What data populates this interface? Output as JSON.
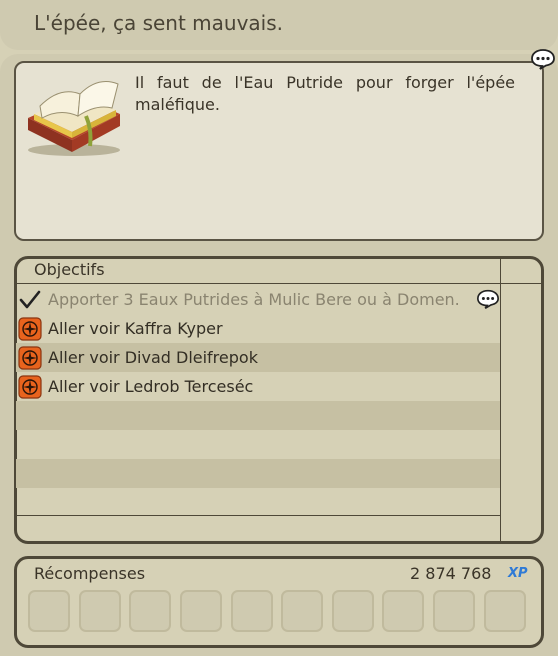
{
  "header": {
    "title": "L'épée, ça sent mauvais."
  },
  "description": {
    "text": "Il faut de l'Eau Putride pour forger l'épée maléfique."
  },
  "objectives": {
    "heading": "Objectifs",
    "items": [
      {
        "label": "Apporter 3 Eaux Putrides à Mulic Bere ou à Domen.",
        "status": "done"
      },
      {
        "label": "Aller voir Kaffra Kyper",
        "status": "pending"
      },
      {
        "label": "Aller voir Divad Dleifrepok",
        "status": "pending"
      },
      {
        "label": "Aller voir Ledrob Terceséc",
        "status": "pending"
      }
    ]
  },
  "rewards": {
    "heading": "Récompenses",
    "xp_value": "2 874 768",
    "xp_badge": "XP"
  },
  "colors": {
    "panel": "#cfcab0",
    "border": "#4e4838",
    "objective_icon": "#e8631d",
    "xp_badge": "#2f7ad6"
  },
  "icons": [
    "book-icon",
    "chat-bubble-icon",
    "checkmark-icon",
    "compass-icon"
  ]
}
